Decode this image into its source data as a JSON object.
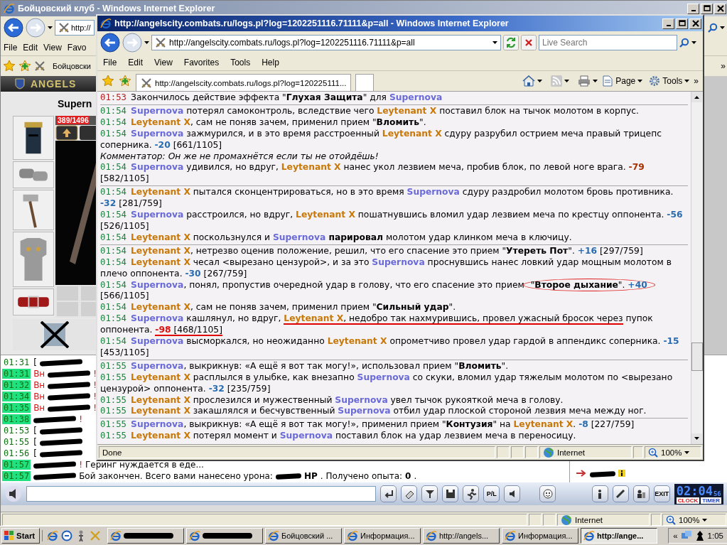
{
  "background_window": {
    "title": "Бойцовский клуб - Windows Internet Explorer",
    "address": "http://",
    "menu": [
      "File",
      "Edit",
      "View",
      "Favo"
    ],
    "tab": "Бойцовски",
    "chevron": "»",
    "game": {
      "logo": "ANGELS",
      "character_name": "Supern",
      "hp": "389/1496"
    },
    "chat": [
      {
        "time": "01:31",
        "highlighted": false,
        "parts": [
          {
            "kind": "text",
            "text": "["
          },
          {
            "kind": "redacted"
          }
        ]
      },
      {
        "time": "01:31",
        "highlighted": true,
        "parts": [
          {
            "kind": "warning",
            "text": "Вн"
          },
          {
            "kind": "redacted"
          },
          {
            "kind": "warning",
            "text": "!"
          }
        ]
      },
      {
        "time": "01:32",
        "highlighted": true,
        "parts": [
          {
            "kind": "warning",
            "text": "Вн"
          },
          {
            "kind": "redacted"
          },
          {
            "kind": "warning",
            "text": "!"
          }
        ]
      },
      {
        "time": "01:34",
        "highlighted": true,
        "parts": [
          {
            "kind": "warning",
            "text": "Вн"
          },
          {
            "kind": "redacted"
          },
          {
            "kind": "warning",
            "text": "!"
          }
        ]
      },
      {
        "time": "01:35",
        "highlighted": true,
        "parts": [
          {
            "kind": "warning",
            "text": "Вн"
          },
          {
            "kind": "redacted"
          },
          {
            "kind": "warning",
            "text": "!"
          }
        ]
      },
      {
        "time": "01:38",
        "highlighted": true,
        "parts": [
          {
            "kind": "redacted"
          },
          {
            "kind": "warning",
            "text": "!"
          }
        ]
      },
      {
        "time": "01:53",
        "highlighted": false,
        "parts": [
          {
            "kind": "text",
            "text": "["
          },
          {
            "kind": "redacted"
          }
        ]
      },
      {
        "time": "01:55",
        "highlighted": false,
        "parts": [
          {
            "kind": "text",
            "text": "["
          },
          {
            "kind": "redacted"
          }
        ]
      },
      {
        "time": "01:56",
        "highlighted": false,
        "parts": [
          {
            "kind": "text",
            "text": "["
          },
          {
            "kind": "redacted"
          }
        ]
      },
      {
        "time": "01:57",
        "highlighted": true,
        "parts": [
          {
            "kind": "redacted"
          },
          {
            "kind": "warning",
            "text": "!"
          },
          {
            "kind": "text",
            "text": "Геринг нуждается в еде..."
          }
        ]
      },
      {
        "time": "01:57",
        "highlighted": true,
        "parts": [
          {
            "kind": "redacted"
          },
          {
            "kind": "text",
            "text": "Бой закончен. Всего вами нанесено урона:"
          },
          {
            "kind": "redacted"
          },
          {
            "kind": "bold",
            "text": "HP"
          },
          {
            "kind": "text",
            "text": ". Получено опыта:"
          },
          {
            "kind": "bold",
            "text": "0"
          },
          {
            "kind": "text",
            "text": "."
          }
        ]
      }
    ],
    "chat_bar": {
      "pl_button": "P/L",
      "exit_label": "EXIT",
      "clock": "02:04",
      "seconds": "56",
      "clock_label": "CLOCK",
      "timer_label": "TIMER"
    },
    "status_zone": "Internet",
    "zoom": "100%"
  },
  "log_window": {
    "title": "http://angelscity.combats.ru/logs.pl?log=1202251116.71111&p=all - Windows Internet Explorer",
    "address": "http://angelscity.combats.ru/logs.pl?log=1202251116.71111&p=all",
    "search": {
      "placeholder": "Live Search"
    },
    "menu": [
      "File",
      "Edit",
      "View",
      "Favorites",
      "Tools",
      "Help"
    ],
    "tab": "http://angelscity.combats.ru/logs.pl?log=120225111...",
    "toolbar": [
      "Page",
      "Tools"
    ],
    "chevron": "»",
    "log": [
      {
        "entries": [
          {
            "kind": "system",
            "time": "01:53",
            "parts": [
              {
                "kind": "text",
                "text": "Закончилось действие эффекта \""
              },
              {
                "kind": "bold",
                "text": "Глухая Защита"
              },
              {
                "kind": "text",
                "text": "\" для "
              },
              {
                "kind": "p1",
                "text": "Supernova"
              }
            ]
          }
        ]
      },
      {
        "entries": [
          {
            "kind": "action",
            "time": "01:54",
            "parts": [
              {
                "kind": "p1",
                "text": "Supernova"
              },
              {
                "kind": "text",
                "text": " потерял самоконтроль, вследствие чего "
              },
              {
                "kind": "p2",
                "text": "Leytenant X"
              },
              {
                "kind": "text",
                "text": " поставил блок на тычок молотом в корпус."
              }
            ]
          },
          {
            "kind": "action",
            "time": "01:54",
            "parts": [
              {
                "kind": "p2",
                "text": "Leytenant X"
              },
              {
                "kind": "text",
                "text": ", сам не поняв зачем, применил прием \""
              },
              {
                "kind": "bold",
                "text": "Вломить"
              },
              {
                "kind": "text",
                "text": "\"."
              }
            ]
          },
          {
            "kind": "action",
            "time": "01:54",
            "parts": [
              {
                "kind": "p1",
                "text": "Supernova"
              },
              {
                "kind": "text",
                "text": " зажмурился, и в это время расстроенный "
              },
              {
                "kind": "p2",
                "text": "Leytenant X"
              },
              {
                "kind": "text",
                "text": " сдуру разрубил острием меча правый трицепс соперника. "
              },
              {
                "kind": "damage",
                "text": "-20",
                "color": "#2a6cb0"
              },
              {
                "kind": "text",
                "text": " [661/1105]"
              }
            ]
          },
          {
            "kind": "comment",
            "parts": [
              {
                "kind": "text",
                "text": "Комментатор: Он же не промахнётся если ты не отойдёшь!"
              }
            ]
          },
          {
            "kind": "action",
            "time": "01:54",
            "parts": [
              {
                "kind": "p1",
                "text": "Supernova"
              },
              {
                "kind": "text",
                "text": " удивился, но вдруг, "
              },
              {
                "kind": "p2",
                "text": "Leytenant X"
              },
              {
                "kind": "text",
                "text": " нанес укол лезвием меча, пробив блок, по левой ноге врага. "
              },
              {
                "kind": "damage",
                "text": "-79",
                "color": "#a83000"
              },
              {
                "kind": "text",
                "text": " [582/1105]"
              }
            ]
          }
        ]
      },
      {
        "entries": [
          {
            "kind": "action",
            "time": "01:54",
            "parts": [
              {
                "kind": "p2",
                "text": "Leytenant X"
              },
              {
                "kind": "text",
                "text": " пытался сконцентрироваться, но в это время "
              },
              {
                "kind": "p1",
                "text": "Supernova"
              },
              {
                "kind": "text",
                "text": " сдуру раздробил молотом бровь противника. "
              },
              {
                "kind": "damage",
                "text": "-32",
                "color": "#2a6cb0"
              },
              {
                "kind": "text",
                "text": " [281/759]"
              }
            ]
          },
          {
            "kind": "action",
            "time": "01:54",
            "parts": [
              {
                "kind": "p1",
                "text": "Supernova"
              },
              {
                "kind": "text",
                "text": " расстроился, но вдруг, "
              },
              {
                "kind": "p2",
                "text": "Leytenant X"
              },
              {
                "kind": "text",
                "text": " пошатнувшись вломил удар лезвием меча по крестцу оппонента. "
              },
              {
                "kind": "damage",
                "text": "-56",
                "color": "#2a6cb0"
              },
              {
                "kind": "text",
                "text": " [526/1105]"
              }
            ]
          },
          {
            "kind": "action",
            "time": "01:54",
            "parts": [
              {
                "kind": "p2",
                "text": "Leytenant X"
              },
              {
                "kind": "text",
                "text": " поскользнулся и "
              },
              {
                "kind": "p1",
                "text": "Supernova"
              },
              {
                "kind": "bold",
                "text": " парировал"
              },
              {
                "kind": "text",
                "text": " молотом удар клинком меча в ключицу."
              }
            ]
          }
        ]
      },
      {
        "entries": [
          {
            "kind": "action",
            "time": "01:54",
            "parts": [
              {
                "kind": "p2",
                "text": "Leytenant X"
              },
              {
                "kind": "text",
                "text": ", нетрезво оценив положение, решил, что его спасение это прием \""
              },
              {
                "kind": "bold",
                "text": "Утереть Пот"
              },
              {
                "kind": "text",
                "text": "\". "
              },
              {
                "kind": "damage",
                "text": "+16",
                "color": "#2a6cb0"
              },
              {
                "kind": "text",
                "text": " [297/759]"
              }
            ]
          },
          {
            "kind": "action",
            "time": "01:54",
            "parts": [
              {
                "kind": "p2",
                "text": "Leytenant X"
              },
              {
                "kind": "text",
                "text": " чесал <вырезано цензурой>, и за это "
              },
              {
                "kind": "p1",
                "text": "Supernova"
              },
              {
                "kind": "text",
                "text": " проснувшись нанес ловкий удар мощным молотом в плечо оппонента. "
              },
              {
                "kind": "damage",
                "text": "-30",
                "color": "#2a6cb0"
              },
              {
                "kind": "text",
                "text": " [267/759]"
              }
            ]
          },
          {
            "kind": "action",
            "time": "01:54",
            "parts": [
              {
                "kind": "p1",
                "text": "Supernova"
              },
              {
                "kind": "text",
                "text": ", понял, пропустив очередной удар в голову, что его спасение это прием "
              },
              {
                "kind": "text",
                "text": "\"",
                "circled": true
              },
              {
                "kind": "bold",
                "text": "Второе дыхание",
                "circled": true
              },
              {
                "kind": "text",
                "text": "\". ",
                "circled": true
              },
              {
                "kind": "damage",
                "text": "+40",
                "color": "#2a6cb0",
                "circled": true
              },
              {
                "kind": "text",
                "text": " [566/1105]"
              }
            ]
          },
          {
            "kind": "action",
            "time": "01:54",
            "parts": [
              {
                "kind": "p2",
                "text": "Leytenant X"
              },
              {
                "kind": "text",
                "text": ", сам не поняв зачем, применил прием \""
              },
              {
                "kind": "bold",
                "text": "Сильный удар"
              },
              {
                "kind": "text",
                "text": "\"."
              }
            ]
          },
          {
            "kind": "action",
            "time": "01:54",
            "parts": [
              {
                "kind": "p1",
                "text": "Supernova"
              },
              {
                "kind": "text",
                "text": " кашлянул, но вдруг, "
              },
              {
                "kind": "p2",
                "text": "Leytenant X",
                "underlined": true
              },
              {
                "kind": "text",
                "text": ", недобро так нахмурившись, провел ужасный бросок через",
                "underlined": true
              },
              {
                "kind": "text",
                "text": " пупок оппонента. "
              },
              {
                "kind": "damage",
                "text": "-98",
                "color": "#e01010",
                "underlined": true
              },
              {
                "kind": "text",
                "text": " [468/1105]",
                "underlined": true
              }
            ]
          },
          {
            "kind": "action",
            "time": "01:54",
            "parts": [
              {
                "kind": "p1",
                "text": "Supernova"
              },
              {
                "kind": "text",
                "text": " высморкался, но неожиданно "
              },
              {
                "kind": "p2",
                "text": "Leytenant X"
              },
              {
                "kind": "text",
                "text": " опрометчиво провел удар гардой в аппендикс соперника. "
              },
              {
                "kind": "damage",
                "text": "-15",
                "color": "#2a6cb0"
              },
              {
                "kind": "text",
                "text": " [453/1105]"
              }
            ]
          }
        ]
      },
      {
        "entries": [
          {
            "kind": "action",
            "time": "01:55",
            "parts": [
              {
                "kind": "p1",
                "text": "Supernova"
              },
              {
                "kind": "text",
                "text": ", выкрикнув: «А ещё я вот так могу!», использовал прием \""
              },
              {
                "kind": "bold",
                "text": "Вломить"
              },
              {
                "kind": "text",
                "text": "\"."
              }
            ]
          },
          {
            "kind": "action",
            "time": "01:55",
            "parts": [
              {
                "kind": "p2",
                "text": "Leytenant X"
              },
              {
                "kind": "text",
                "text": " расплылся в улыбке, как внезапно "
              },
              {
                "kind": "p1",
                "text": "Supernova"
              },
              {
                "kind": "text",
                "text": " со скуки, вломил удар тяжелым молотом по <вырезано цензурой> оппонента. "
              },
              {
                "kind": "damage",
                "text": "-32",
                "color": "#2a6cb0"
              },
              {
                "kind": "text",
                "text": " [235/759]"
              }
            ]
          },
          {
            "kind": "action",
            "time": "01:55",
            "parts": [
              {
                "kind": "p2",
                "text": "Leytenant X"
              },
              {
                "kind": "text",
                "text": " прослезился и мужественный "
              },
              {
                "kind": "p1",
                "text": "Supernova"
              },
              {
                "kind": "text",
                "text": " увел тычок рукояткой меча в голову."
              }
            ]
          },
          {
            "kind": "action",
            "time": "01:55",
            "parts": [
              {
                "kind": "p2",
                "text": "Leytenant X"
              },
              {
                "kind": "text",
                "text": " закашлялся и бесчувственный "
              },
              {
                "kind": "p1",
                "text": "Supernova"
              },
              {
                "kind": "text",
                "text": " отбил удар плоской стороной лезвия меча между ног."
              }
            ]
          }
        ]
      },
      {
        "entries": [
          {
            "kind": "action",
            "time": "01:55",
            "parts": [
              {
                "kind": "p1",
                "text": "Supernova"
              },
              {
                "kind": "text",
                "text": ", выкрикнув: «А ещё я вот так могу!», применил прием \""
              },
              {
                "kind": "bold",
                "text": "Контузия"
              },
              {
                "kind": "text",
                "text": "\" на "
              },
              {
                "kind": "p2",
                "text": "Leytenant X"
              },
              {
                "kind": "text",
                "text": ". "
              },
              {
                "kind": "damage",
                "text": "-8",
                "color": "#2a6cb0"
              },
              {
                "kind": "text",
                "text": " [227/759]"
              }
            ]
          },
          {
            "kind": "action",
            "time": "01:55",
            "parts": [
              {
                "kind": "p2",
                "text": "Leytenant X"
              },
              {
                "kind": "text",
                "text": " потерял момент и "
              },
              {
                "kind": "p1",
                "text": "Supernova"
              },
              {
                "kind": "text",
                "text": " поставил блок на удар лезвием меча в переносицу."
              }
            ]
          }
        ]
      }
    ],
    "status": "Done",
    "status_zone": "Internet",
    "zoom": "100%"
  },
  "taskbar": {
    "start": "Start",
    "tasks": [
      {
        "kind": "redacted",
        "selected": false
      },
      {
        "kind": "redacted",
        "selected": false
      },
      {
        "kind": "window",
        "label": "Бойцовский ...",
        "selected": false
      },
      {
        "kind": "window",
        "label": "Информация...",
        "selected": false
      },
      {
        "kind": "window",
        "label": "http://angels...",
        "selected": false
      },
      {
        "kind": "window",
        "label": "Информация...",
        "selected": false
      },
      {
        "kind": "window",
        "label": "http://ange...",
        "selected": true
      }
    ],
    "tray_more": "«",
    "time": "1:05"
  }
}
